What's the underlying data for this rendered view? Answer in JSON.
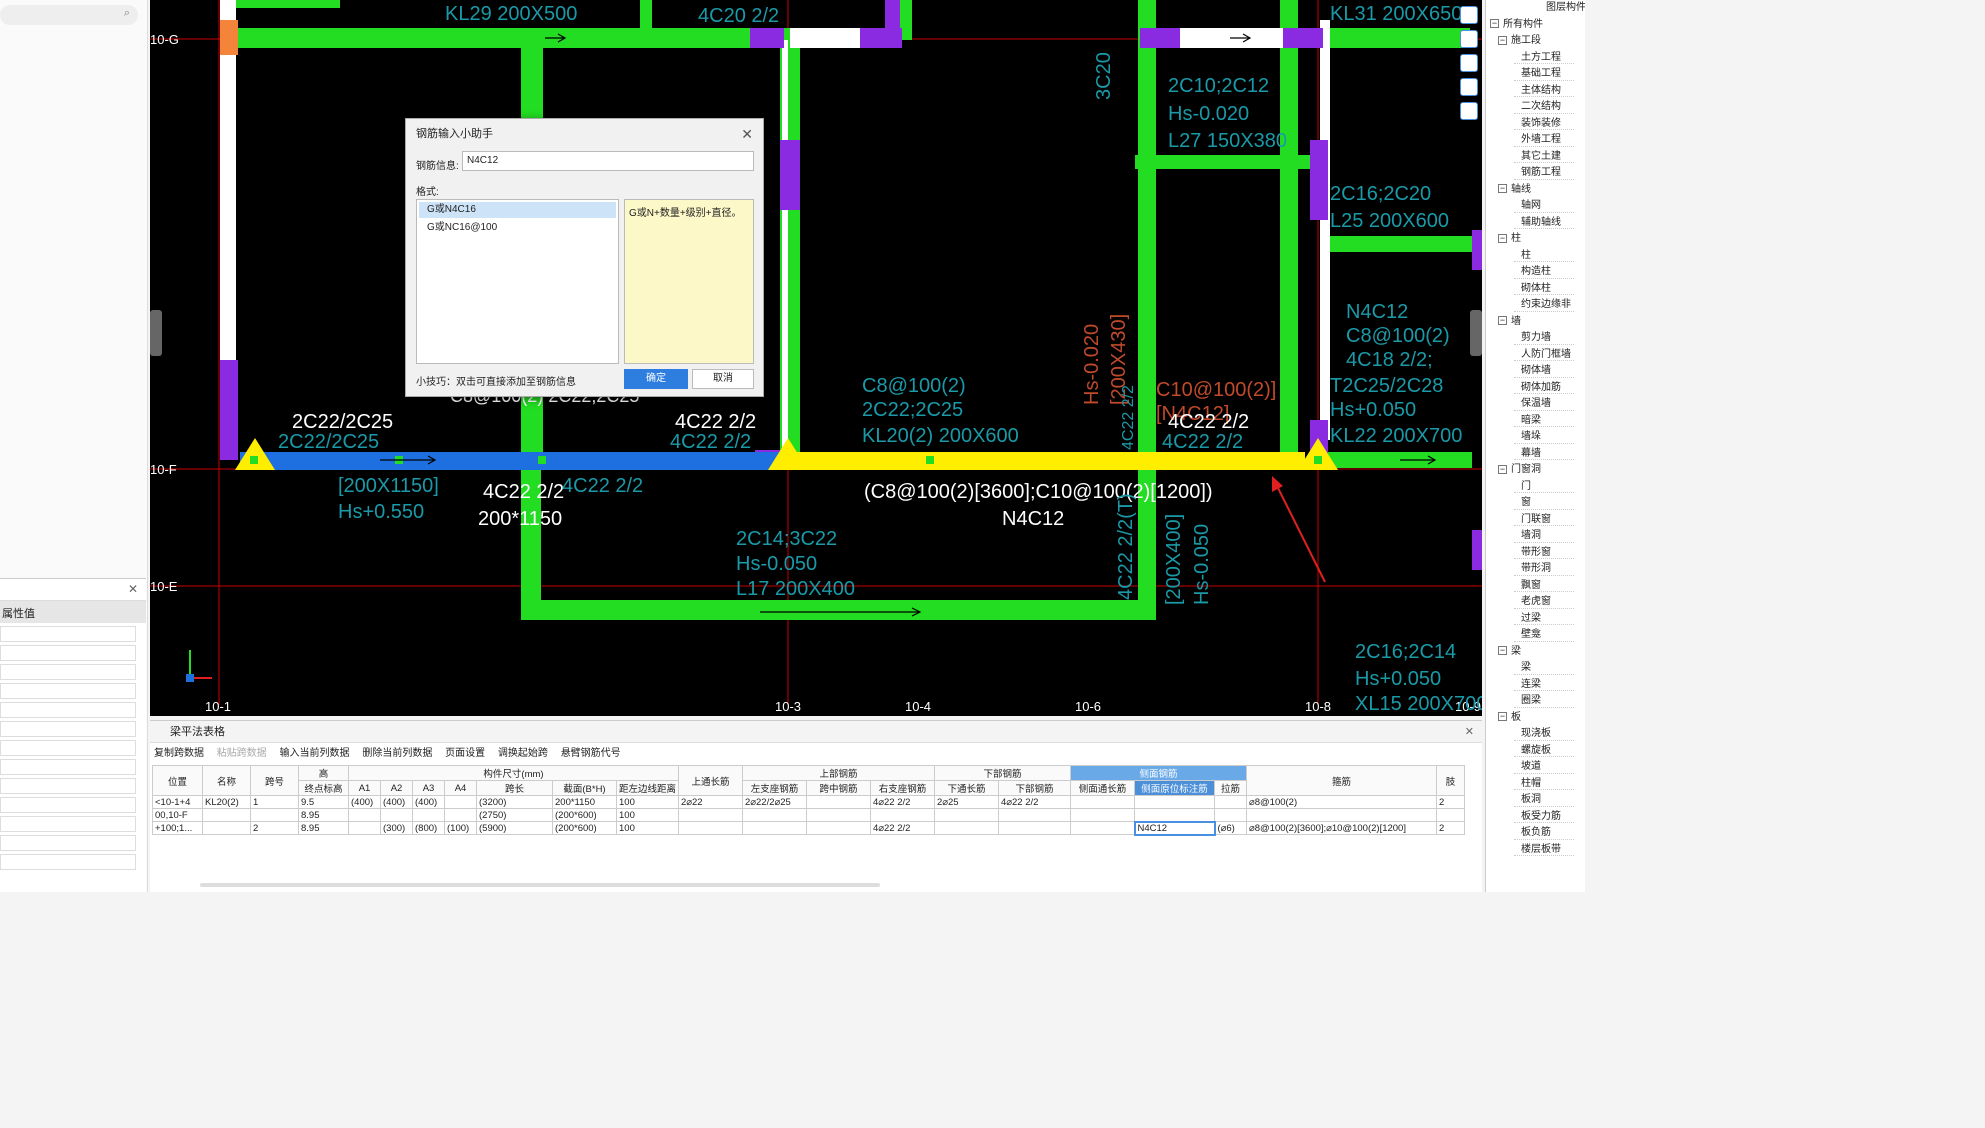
{
  "left_panel": {
    "prop_header": "属性值",
    "search_icon": "search-icon"
  },
  "tree": {
    "top": "图层构件",
    "items": [
      {
        "lv": 0,
        "box": "−",
        "label": "所有构件"
      },
      {
        "lv": 1,
        "box": "−",
        "label": "施工段"
      },
      {
        "lv": 2,
        "label": "土方工程"
      },
      {
        "lv": 2,
        "label": "基础工程"
      },
      {
        "lv": 2,
        "label": "主体结构"
      },
      {
        "lv": 2,
        "label": "二次结构"
      },
      {
        "lv": 2,
        "label": "装饰装修"
      },
      {
        "lv": 2,
        "label": "外墙工程"
      },
      {
        "lv": 2,
        "label": "其它土建"
      },
      {
        "lv": 2,
        "label": "钢筋工程"
      },
      {
        "lv": 1,
        "box": "−",
        "label": "轴线"
      },
      {
        "lv": 2,
        "label": "轴网"
      },
      {
        "lv": 2,
        "label": "辅助轴线"
      },
      {
        "lv": 1,
        "box": "−",
        "label": "柱"
      },
      {
        "lv": 2,
        "label": "柱"
      },
      {
        "lv": 2,
        "label": "构造柱"
      },
      {
        "lv": 2,
        "label": "砌体柱"
      },
      {
        "lv": 2,
        "label": "约束边缘非"
      },
      {
        "lv": 1,
        "box": "−",
        "label": "墙"
      },
      {
        "lv": 2,
        "label": "剪力墙"
      },
      {
        "lv": 2,
        "label": "人防门框墙"
      },
      {
        "lv": 2,
        "label": "砌体墙"
      },
      {
        "lv": 2,
        "label": "砌体加筋"
      },
      {
        "lv": 2,
        "label": "保温墙"
      },
      {
        "lv": 2,
        "label": "暗梁"
      },
      {
        "lv": 2,
        "label": "墙垛"
      },
      {
        "lv": 2,
        "label": "幕墙"
      },
      {
        "lv": 1,
        "box": "−",
        "label": "门窗洞"
      },
      {
        "lv": 2,
        "label": "门"
      },
      {
        "lv": 2,
        "label": "窗"
      },
      {
        "lv": 2,
        "label": "门联窗"
      },
      {
        "lv": 2,
        "label": "墙洞"
      },
      {
        "lv": 2,
        "label": "带形窗"
      },
      {
        "lv": 2,
        "label": "带形洞"
      },
      {
        "lv": 2,
        "label": "飘窗"
      },
      {
        "lv": 2,
        "label": "老虎窗"
      },
      {
        "lv": 2,
        "label": "过梁"
      },
      {
        "lv": 2,
        "label": "壁龛"
      },
      {
        "lv": 1,
        "box": "−",
        "label": "梁"
      },
      {
        "lv": 2,
        "label": "梁"
      },
      {
        "lv": 2,
        "label": "连梁"
      },
      {
        "lv": 2,
        "label": "圈梁"
      },
      {
        "lv": 1,
        "box": "−",
        "label": "板"
      },
      {
        "lv": 2,
        "label": "现浇板"
      },
      {
        "lv": 2,
        "label": "螺旋板"
      },
      {
        "lv": 2,
        "label": "坡道"
      },
      {
        "lv": 2,
        "label": "柱帽"
      },
      {
        "lv": 2,
        "label": "板洞"
      },
      {
        "lv": 2,
        "label": "板受力筋"
      },
      {
        "lv": 2,
        "label": "板负筋"
      },
      {
        "lv": 2,
        "label": "楼层板带"
      }
    ]
  },
  "cad": {
    "axes": {
      "rows": [
        "10-G",
        "10-F",
        "10-E"
      ],
      "cols": [
        "10-1",
        "10-3",
        "10-4",
        "10-6",
        "10-8",
        "10-9"
      ]
    },
    "labels": [
      {
        "t": "KL29 200X500",
        "c": "teal"
      },
      {
        "t": "4C20 2/2",
        "c": "teal"
      },
      {
        "t": "KL31 200X650",
        "c": "teal"
      },
      {
        "t": "3C20",
        "c": "teal"
      },
      {
        "t": "2C10;2C12",
        "c": "teal"
      },
      {
        "t": "Hs-0.020",
        "c": "teal"
      },
      {
        "t": "L27 150X380",
        "c": "teal"
      },
      {
        "t": "2C16;2C20",
        "c": "teal"
      },
      {
        "t": "L25 200X600",
        "c": "teal"
      },
      {
        "t": "N4C12",
        "c": "teal"
      },
      {
        "t": "C8@100(2)",
        "c": "teal"
      },
      {
        "t": "4C18 2/2;",
        "c": "teal"
      },
      {
        "t": "T2C25/2C28",
        "c": "teal"
      },
      {
        "t": "Hs+0.050",
        "c": "teal"
      },
      {
        "t": "KL22 200X700",
        "c": "teal"
      },
      {
        "t": "C8@100(2)",
        "c": "teal"
      },
      {
        "t": "2C22;2C25",
        "c": "teal"
      },
      {
        "t": "KL20(2) 200X600",
        "c": "teal"
      },
      {
        "t": "Hs-0.020",
        "c": "red"
      },
      {
        "t": "[200X430]",
        "c": "red"
      },
      {
        "t": "C10@100(2)]",
        "c": "red"
      },
      {
        "t": "[N4C12]",
        "c": "red"
      },
      {
        "t": "2C22/2C25",
        "c": "white"
      },
      {
        "t": "2C22/2C25",
        "c": "teal"
      },
      {
        "t": "4C22 2/2",
        "c": "white"
      },
      {
        "t": "4C22 2/2",
        "c": "teal"
      },
      {
        "t": "4C22 2/2",
        "c": "white"
      },
      {
        "t": "4C22 2/2",
        "c": "teal"
      },
      {
        "t": "[200X1150]",
        "c": "teal"
      },
      {
        "t": "Hs+0.550",
        "c": "teal"
      },
      {
        "t": "4C22 2/2",
        "c": "white"
      },
      {
        "t": "200*1150",
        "c": "white"
      },
      {
        "t": "4C22 2/2",
        "c": "teal"
      },
      {
        "t": "(C8@100(2)[3600];C10@100(2)[1200])",
        "c": "white"
      },
      {
        "t": "N4C12",
        "c": "white"
      },
      {
        "t": "2C14;3C22",
        "c": "teal"
      },
      {
        "t": "Hs-0.050",
        "c": "teal"
      },
      {
        "t": "L17 200X400",
        "c": "teal"
      },
      {
        "t": "2C16;2C14",
        "c": "teal"
      },
      {
        "t": "Hs+0.050",
        "c": "teal"
      },
      {
        "t": "XL15 200X700",
        "c": "teal"
      },
      {
        "t": "[200X400]",
        "c": "teal"
      },
      {
        "t": "Hs-0.050",
        "c": "teal"
      },
      {
        "t": "4C22 2/2(T)",
        "c": "teal"
      },
      {
        "t": "4C22 2/2",
        "c": "teal"
      },
      {
        "t": "C8@100(2) 2C22;2C25",
        "c": "white"
      }
    ]
  },
  "dialog": {
    "title": "钢筋输入小助手",
    "info_label": "钢筋信息:",
    "info_value": "N4C12",
    "format_label": "格式:",
    "formats": [
      "G或N4C16",
      "G或NC16@100"
    ],
    "note": "G或N+数量+级别+直径。",
    "tip": "小技巧：双击可直接添加至钢筋信息",
    "ok": "确定",
    "cancel": "取消"
  },
  "bottom": {
    "title": "梁平法表格",
    "toolbar": [
      {
        "label": "复制跨数据",
        "enabled": true
      },
      {
        "label": "粘贴跨数据",
        "enabled": false
      },
      {
        "label": "输入当前列数据",
        "enabled": true
      },
      {
        "label": "删除当前列数据",
        "enabled": true
      },
      {
        "label": "页面设置",
        "enabled": true
      },
      {
        "label": "调换起始跨",
        "enabled": true
      },
      {
        "label": "悬臂钢筋代号",
        "enabled": true
      }
    ],
    "groups": {
      "height": "高",
      "size": "构件尺寸(mm)",
      "top": "上部钢筋",
      "bottom": "下部钢筋",
      "side": "侧面钢筋"
    },
    "cols": [
      "位置",
      "名称",
      "跨号",
      "终点标高",
      "A1",
      "A2",
      "A3",
      "A4",
      "跨长",
      "截面(B*H)",
      "距左边线距离",
      "上通长筋",
      "左支座钢筋",
      "跨中钢筋",
      "右支座钢筋",
      "下通长筋",
      "下部钢筋",
      "侧面通长筋",
      "侧面原位标注筋",
      "拉筋",
      "箍筋",
      "肢"
    ],
    "rows": [
      {
        "num": "1",
        "pos": "<10-1+4",
        "name": "KL20(2)",
        "span": "1",
        "elev": "9.5",
        "a1": "(400)",
        "a2": "(400)",
        "a3": "(400)",
        "a4": "",
        "len": "(3200)",
        "sec": "200*1150",
        "dist": "100",
        "top": "2⌀22",
        "left": "2⌀22/2⌀25",
        "mid": "",
        "right": "4⌀22 2/2",
        "btm": "2⌀25",
        "bar": "4⌀22 2/2",
        "sidec": "",
        "sideo": "",
        "tie": "",
        "hoop": "⌀8@100(2)",
        "limb": "2"
      },
      {
        "num": "2",
        "pos": "00,10-F",
        "name": "",
        "span": "",
        "elev": "8.95",
        "a1": "",
        "a2": "",
        "a3": "",
        "a4": "",
        "len": "(2750)",
        "sec": "(200*600)",
        "dist": "100",
        "top": "",
        "left": "",
        "mid": "",
        "right": "",
        "btm": "",
        "bar": "",
        "sidec": "",
        "sideo": "",
        "tie": "",
        "hoop": "",
        "limb": ""
      },
      {
        "num": "3",
        "pos": "+100;1...",
        "name": "",
        "span": "2",
        "elev": "8.95",
        "a1": "",
        "a2": "(300)",
        "a3": "(800)",
        "a4": "(100)",
        "len": "(5900)",
        "sec": "(200*600)",
        "dist": "100",
        "top": "",
        "left": "",
        "mid": "",
        "right": "4⌀22 2/2",
        "btm": "",
        "bar": "",
        "sidec": "",
        "sideo": "N4C12",
        "tie": "(⌀6)",
        "hoop": "⌀8@100(2)[3600];⌀10@100(2)[1200]",
        "limb": "2"
      }
    ]
  }
}
